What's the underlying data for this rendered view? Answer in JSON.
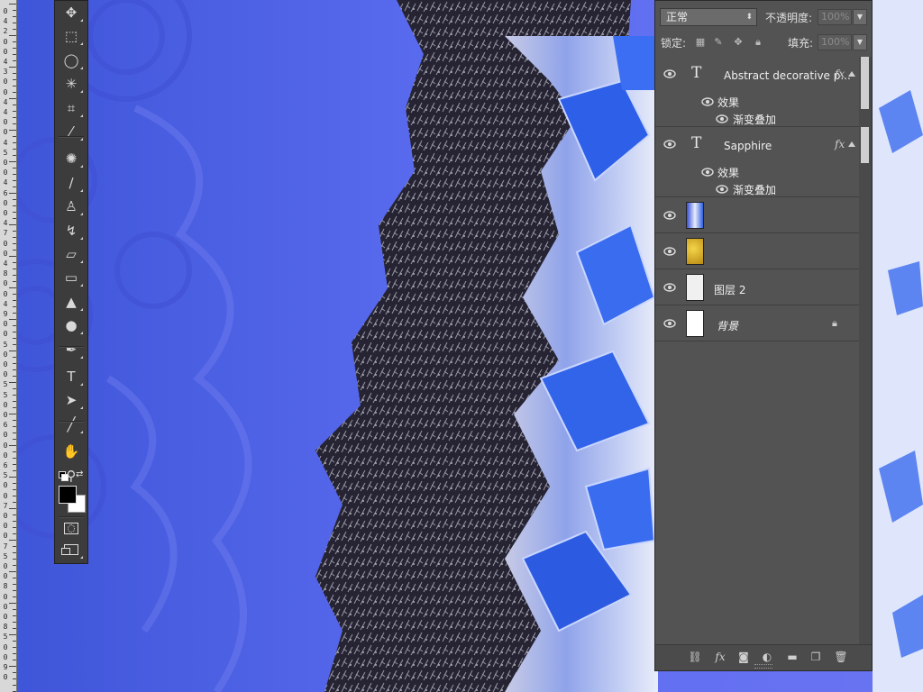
{
  "app": "Photoshop",
  "ruler": {
    "marks": [
      "0",
      "4",
      "2",
      "0",
      "0",
      "4",
      "3",
      "0",
      "0",
      "4",
      "4",
      "0",
      "0",
      "4",
      "5",
      "0",
      "0",
      "4",
      "6",
      "0",
      "0",
      "4",
      "7",
      "0",
      "0",
      "4",
      "8",
      "0",
      "0",
      "4",
      "9",
      "0",
      "0",
      "5",
      "0",
      "0",
      "0",
      "5",
      "5",
      "0",
      "0",
      "6",
      "0",
      "0",
      "0",
      "6",
      "5",
      "0",
      "0",
      "7",
      "0",
      "0",
      "0",
      "7",
      "5",
      "0",
      "0",
      "8",
      "0",
      "0",
      "0",
      "8",
      "5",
      "0",
      "0",
      "9",
      "0"
    ]
  },
  "toolbar": {
    "tools": [
      {
        "name": "move-tool",
        "glyph": "✥"
      },
      {
        "name": "marquee-tool",
        "glyph": "⬚"
      },
      {
        "name": "lasso-tool",
        "glyph": "◯"
      },
      {
        "name": "magic-wand-tool",
        "glyph": "✳"
      },
      {
        "name": "crop-tool",
        "glyph": "⌗"
      },
      {
        "name": "eyedropper-tool",
        "glyph": "⁄"
      },
      {
        "name": "healing-brush-tool",
        "glyph": "✺"
      },
      {
        "name": "brush-tool",
        "glyph": "∕"
      },
      {
        "name": "clone-stamp-tool",
        "glyph": "♙"
      },
      {
        "name": "history-brush-tool",
        "glyph": "↯"
      },
      {
        "name": "eraser-tool",
        "glyph": "▱"
      },
      {
        "name": "gradient-tool",
        "glyph": "▭"
      },
      {
        "name": "blur-tool",
        "glyph": "▲"
      },
      {
        "name": "dodge-tool",
        "glyph": "●"
      },
      {
        "name": "pen-tool",
        "glyph": "✒"
      },
      {
        "name": "type-tool",
        "glyph": "T"
      },
      {
        "name": "path-selection-tool",
        "glyph": "➤"
      },
      {
        "name": "line-tool",
        "glyph": "╱"
      },
      {
        "name": "hand-tool",
        "glyph": "✋"
      },
      {
        "name": "zoom-tool",
        "glyph": "⚲"
      }
    ],
    "fg_color": "#000000",
    "bg_color": "#ffffff"
  },
  "layers_panel": {
    "blend_mode": "正常",
    "opacity_label": "不透明度:",
    "opacity_value": "100%",
    "lock_label": "锁定:",
    "fill_label": "填充:",
    "fill_value": "100%",
    "layers": [
      {
        "type": "text",
        "name": "Abstract decorative p...",
        "fx": "fx",
        "effects_label": "效果",
        "effect": "渐变叠加"
      },
      {
        "type": "text",
        "name": "Sapphire",
        "fx": "fx",
        "effects_label": "效果",
        "effect": "渐变叠加"
      },
      {
        "type": "image",
        "name": "",
        "thumb": "blue-agate"
      },
      {
        "type": "image",
        "name": "",
        "thumb": "gold"
      },
      {
        "type": "image",
        "name": "图层 2",
        "thumb": "white"
      },
      {
        "type": "background",
        "name": "背景",
        "thumb": "white",
        "locked": true
      }
    ]
  },
  "colors": {
    "panel_bg": "#535353",
    "agate_blue": "#4a5fe0",
    "crystal_blue": "#2f5fe0"
  }
}
